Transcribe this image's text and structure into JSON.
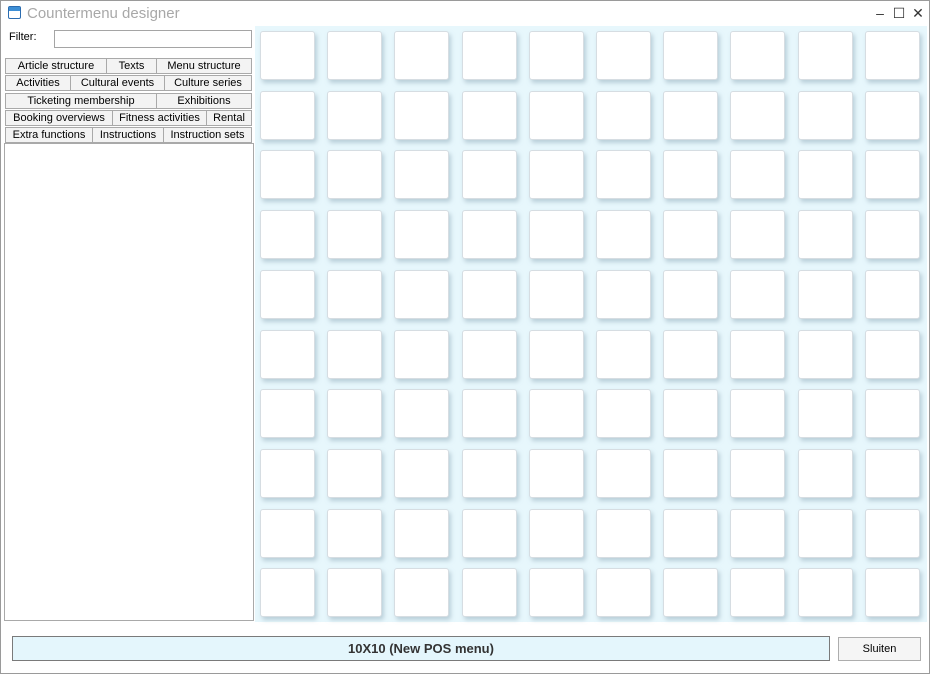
{
  "window": {
    "title": "Countermenu designer"
  },
  "titlebar_buttons": {
    "minimize": "–",
    "maximize": "☐",
    "close": "✕"
  },
  "filter": {
    "label": "Filter:",
    "value": ""
  },
  "tab_rows": [
    [
      "Article structure",
      "Texts",
      "Menu structure"
    ],
    [
      "Activities",
      "Cultural events",
      "Culture series"
    ],
    [
      "Ticketing membership",
      "Exhibitions"
    ],
    [
      "Booking overviews",
      "Fitness activities",
      "Rental"
    ],
    [
      "Extra functions",
      "Instructions",
      "Instruction sets"
    ]
  ],
  "grid": {
    "rows": 10,
    "cols": 10
  },
  "status": {
    "label": "10X10 (New POS menu)"
  },
  "close_button": {
    "label": "Sluiten"
  },
  "colors": {
    "grid_background": "#e7f7fc",
    "status_background": "#e4f6fc"
  }
}
